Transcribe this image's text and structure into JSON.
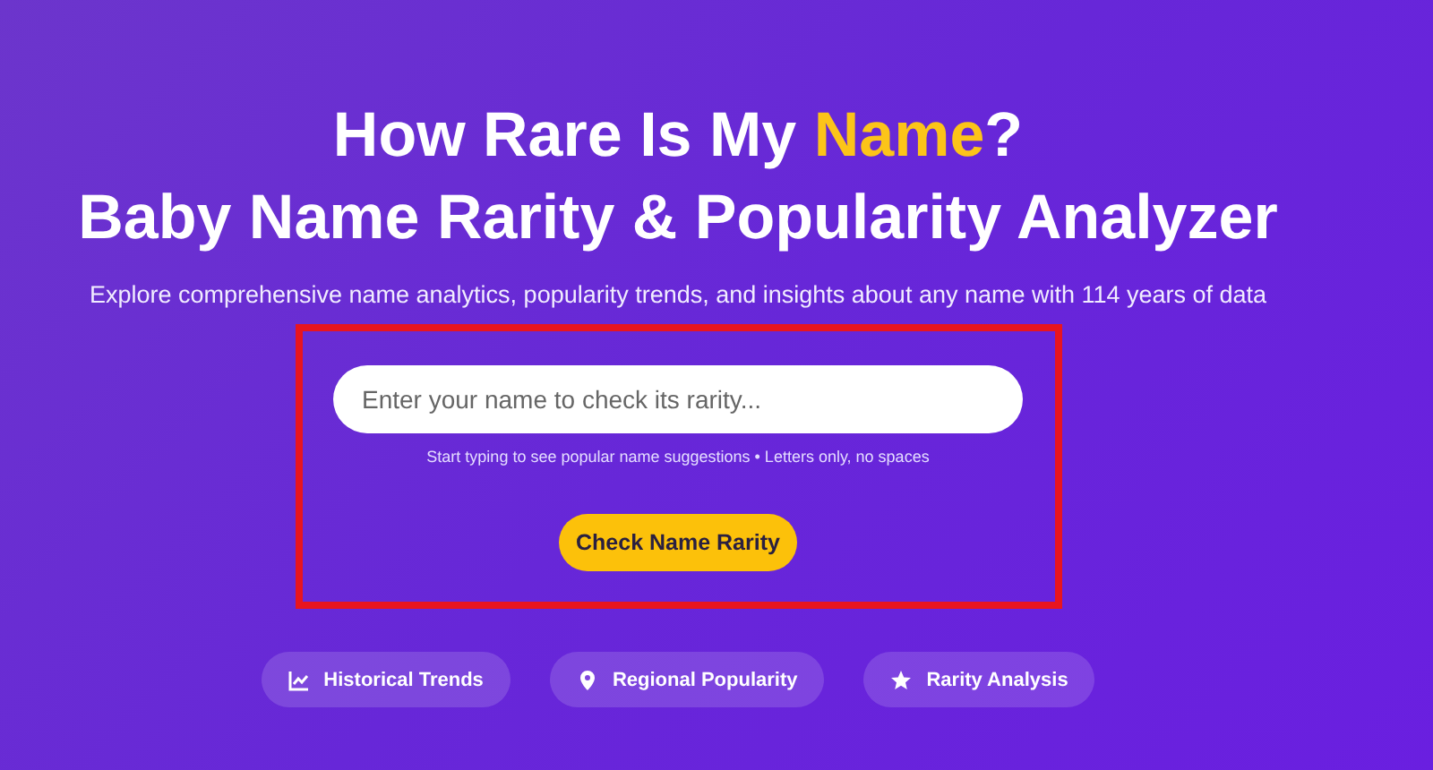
{
  "title_line_1": [
    {
      "text": "How Rare Is My ",
      "highlight": false
    },
    {
      "text": "Name",
      "highlight": true
    },
    {
      "text": "?",
      "highlight": false
    }
  ],
  "title_line_2": "Baby Name Rarity & Popularity Analyzer",
  "subtitle": "Explore comprehensive name analytics, popularity trends, and insights about any name with 114 years of data",
  "search": {
    "placeholder": "Enter your name to check its rarity..."
  },
  "hint": "Start typing to see popular name suggestions • Letters only, no spaces",
  "button": "Check Name Rarity",
  "features": [
    {
      "kind": "chart",
      "label": "Historical Trends"
    },
    {
      "kind": "pin",
      "label": "Regional Popularity"
    },
    {
      "kind": "star",
      "label": "Rarity Analysis"
    }
  ]
}
